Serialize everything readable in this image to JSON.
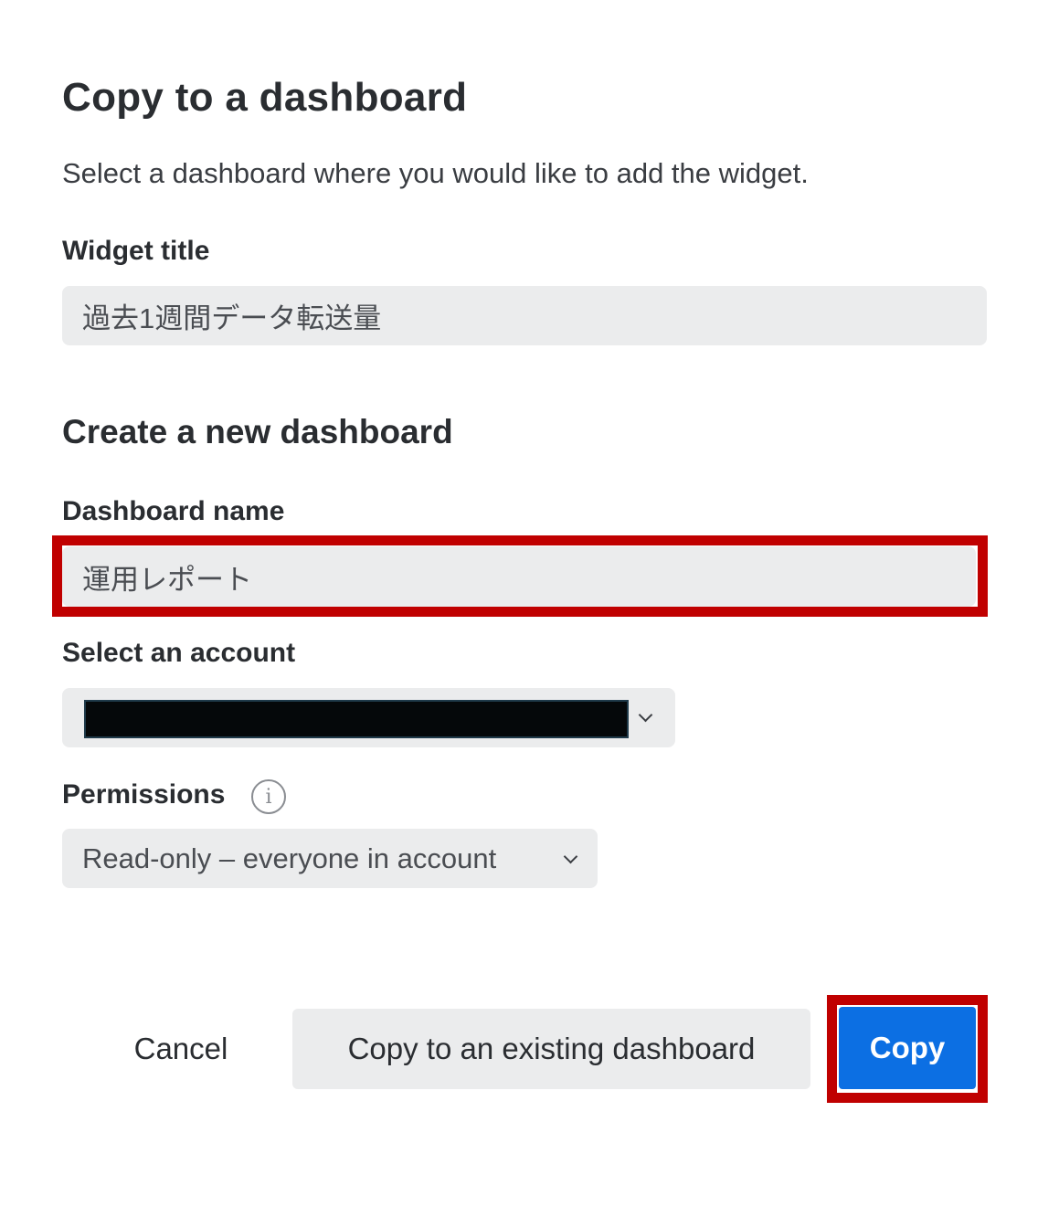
{
  "dialog": {
    "title": "Copy to a dashboard",
    "subtitle": "Select a dashboard where you would like to add the widget."
  },
  "widget_title": {
    "label": "Widget title",
    "value": "過去1週間データ転送量"
  },
  "new_dashboard": {
    "section_title": "Create a new dashboard",
    "name_label": "Dashboard name",
    "name_value": "運用レポート",
    "account_label": "Select an account",
    "account_value": "",
    "permissions_label": "Permissions",
    "permissions_value": "Read-only – everyone in account"
  },
  "icons": {
    "info": "info-icon",
    "chevron": "chevron-down-icon"
  },
  "buttons": {
    "cancel": "Cancel",
    "copy_existing": "Copy to an existing dashboard",
    "copy": "Copy"
  },
  "colors": {
    "primary": "#0c6fe3",
    "highlight": "#c00000",
    "field_bg": "#ebeced"
  }
}
